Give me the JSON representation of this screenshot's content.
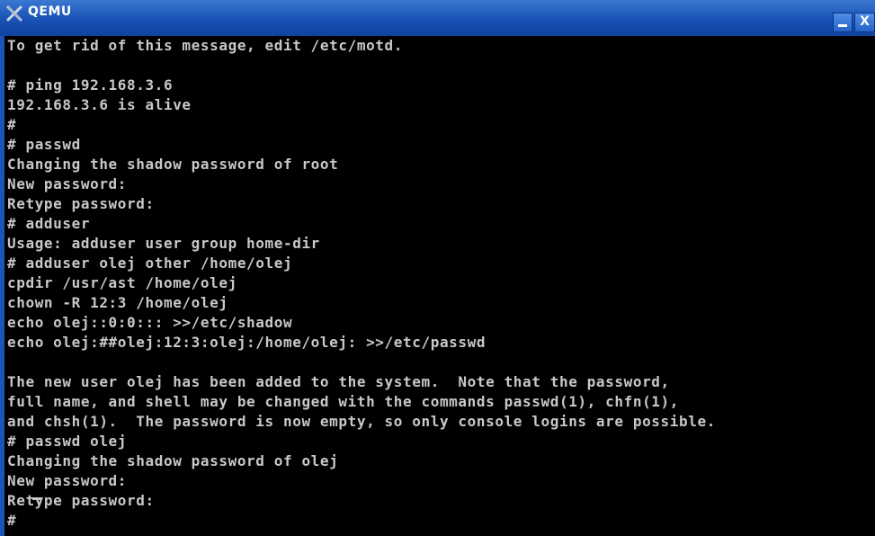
{
  "window": {
    "title": "QEMU",
    "title_color": "#ffffff",
    "titlebar_color": "#1b55b8",
    "minimize_label": "",
    "close_label": "X"
  },
  "console": {
    "text_color": "#c8c8c8",
    "background": "#000000",
    "lines": [
      "To get rid of this message, edit /etc/motd.",
      "",
      "# ping 192.168.3.6",
      "192.168.3.6 is alive",
      "#",
      "# passwd",
      "Changing the shadow password of root",
      "New password:",
      "Retype password:",
      "# adduser",
      "Usage: adduser user group home-dir",
      "# adduser olej other /home/olej",
      "cpdir /usr/ast /home/olej",
      "chown -R 12:3 /home/olej",
      "echo olej::0:0::: >>/etc/shadow",
      "echo olej:##olej:12:3:olej:/home/olej: >>/etc/passwd",
      "",
      "The new user olej has been added to the system.  Note that the password,",
      "full name, and shell may be changed with the commands passwd(1), chfn(1),",
      "and chsh(1).  The password is now empty, so only console logins are possible.",
      "# passwd olej",
      "Changing the shadow password of olej",
      "New password:",
      "Retype password:",
      "#"
    ]
  }
}
